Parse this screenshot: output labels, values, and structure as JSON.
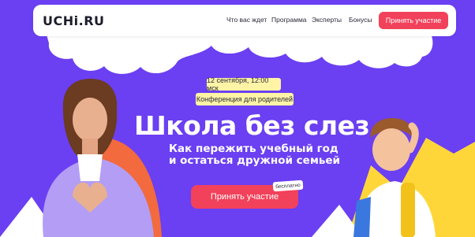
{
  "header": {
    "logo": "UCHi.RU",
    "nav": [
      "Что вас ждет",
      "Программа",
      "Эксперты",
      "Бонусы"
    ],
    "cta_label": "Принять участие"
  },
  "event": {
    "date_time": "12 сентября, 12:00 мск",
    "type": "Конференция для родителей"
  },
  "hero": {
    "title": "Школа без слез",
    "subtitle_line1": "Как пережить учебный год",
    "subtitle_line2": "и остаться дружной семьей"
  },
  "cta_main": {
    "label": "Принять участие",
    "badge": "бесплатно"
  },
  "colors": {
    "background": "#6b3ff2",
    "accent": "#f2415a",
    "pill": "#fff3a6",
    "shape_orange": "#f26a3d",
    "shape_yellow": "#ffd63a"
  }
}
